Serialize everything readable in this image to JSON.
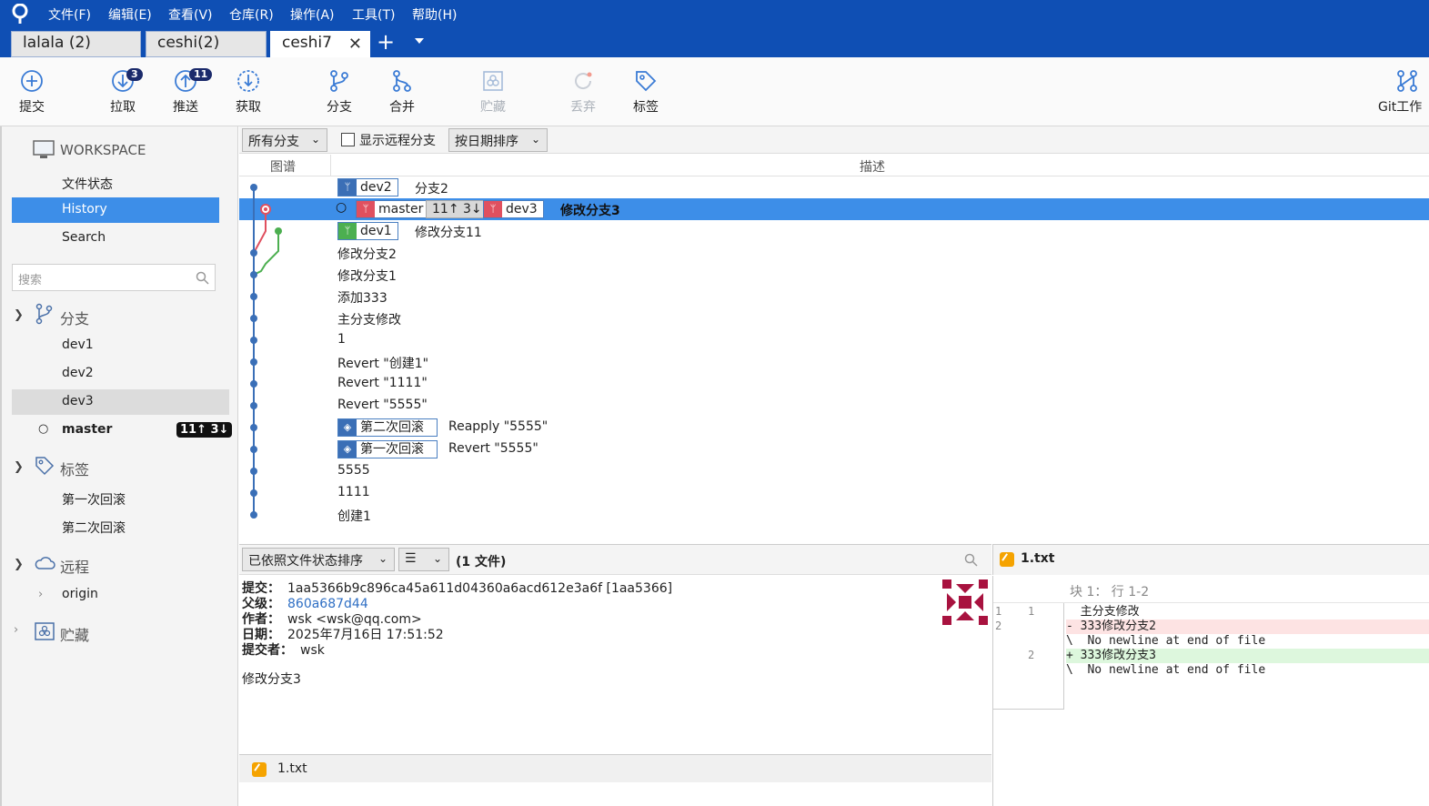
{
  "menu": [
    "文件(F)",
    "编辑(E)",
    "查看(V)",
    "仓库(R)",
    "操作(A)",
    "工具(T)",
    "帮助(H)"
  ],
  "tabs": [
    {
      "label": "lalala (2)"
    },
    {
      "label": "ceshi(2)"
    },
    {
      "label": "ceshi7"
    }
  ],
  "toolbar": {
    "commit": "提交",
    "pull": "拉取",
    "pull_badge": "3",
    "push": "推送",
    "push_badge": "11",
    "fetch": "获取",
    "branch": "分支",
    "merge": "合并",
    "stash": "贮藏",
    "discard": "丢弃",
    "tag": "标签",
    "gitflow": "Git工作"
  },
  "sidebar": {
    "workspace": "WORKSPACE",
    "file_status": "文件状态",
    "history": "History",
    "search": "Search",
    "search_placeholder": "搜索",
    "branches_title": "分支",
    "branches": [
      "dev1",
      "dev2",
      "dev3"
    ],
    "master": "master",
    "master_badge": "11↑ 3↓",
    "tags_title": "标签",
    "tags": [
      "第一次回滚",
      "第二次回滚"
    ],
    "remotes_title": "远程",
    "origin": "origin",
    "stash_title": "贮藏"
  },
  "filter": {
    "branches": "所有分支",
    "show_remote": "显示远程分支",
    "sort": "按日期排序"
  },
  "graph": {
    "col_graph": "图谱",
    "col_desc": "描述",
    "rows": [
      {
        "refs": [
          "dev2"
        ],
        "msg": "分支2"
      },
      {
        "refs": [
          "master",
          "11↑ 3↓",
          "dev3"
        ],
        "msg": "修改分支3"
      },
      {
        "refs": [
          "dev1"
        ],
        "msg": "修改分支11"
      },
      {
        "msg": "修改分支2"
      },
      {
        "msg": "修改分支1"
      },
      {
        "msg": "添加333"
      },
      {
        "msg": "主分支修改"
      },
      {
        "msg": "1"
      },
      {
        "msg": "Revert \"创建1\""
      },
      {
        "msg": "Revert \"1111\""
      },
      {
        "msg": "Revert \"5555\""
      },
      {
        "refs": [
          "第二次回滚"
        ],
        "msg": "Reapply \"5555\""
      },
      {
        "refs": [
          "第一次回滚"
        ],
        "msg": "Revert \"5555\""
      },
      {
        "msg": "5555"
      },
      {
        "msg": "1111"
      },
      {
        "msg": "创建1"
      }
    ]
  },
  "details": {
    "sort_label": "已依照文件状态排序",
    "file_count": "(1 文件)",
    "commit_label": "提交：",
    "commit_value": "1aa5366b9c896ca45a611d04360a6acd612e3a6f [1aa5366]",
    "parent_label": "父级：",
    "parent_value": "860a687d44",
    "author_label": "作者：",
    "author_value": "wsk <wsk@qq.com>",
    "date_label": "日期：",
    "date_value": "2025年7月16日 17:51:52",
    "committer_label": "提交者：",
    "committer_value": "wsk",
    "message": "修改分支3",
    "file": "1.txt"
  },
  "diff": {
    "file": "1.txt",
    "hunk": "块 1： 行 1-2",
    "lines": [
      {
        "old": "1",
        "new": "1",
        "text": "  主分支修改"
      },
      {
        "old": "2",
        "new": "",
        "text": "- 333修改分支2"
      },
      {
        "old": "",
        "new": "",
        "text": "\\  No newline at end of file"
      },
      {
        "old": "",
        "new": "2",
        "text": "+ 333修改分支3"
      },
      {
        "old": "",
        "new": "",
        "text": "\\  No newline at end of file"
      }
    ]
  },
  "colors": {
    "brand": "#0f4fb4",
    "selection": "#3d8ee8",
    "graph_blue": "#3a6fb7",
    "graph_red": "#e0505f",
    "graph_green": "#4caf50"
  }
}
